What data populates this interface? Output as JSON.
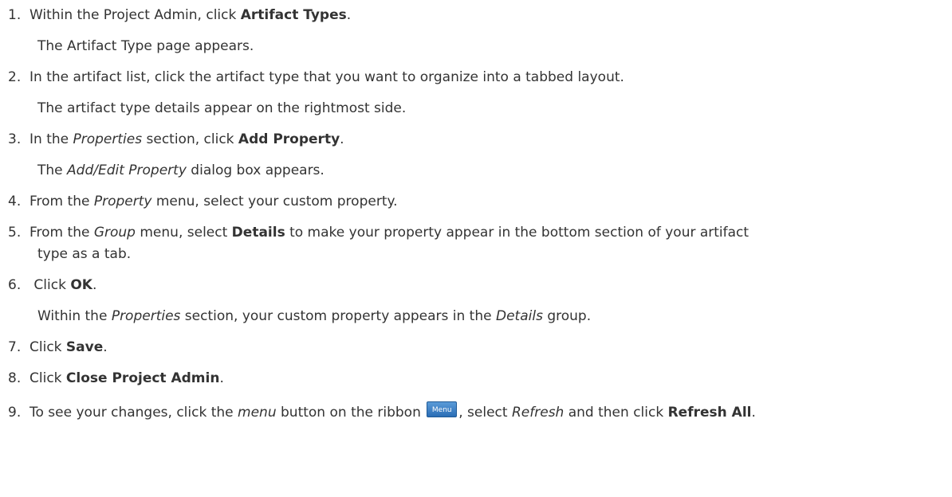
{
  "steps": [
    {
      "num": "1.",
      "pre": "Within the Project Admin, click ",
      "b1": "Artifact Types",
      "post": ".",
      "result": "The Artifact Type page appears."
    },
    {
      "num": "2.",
      "text": "In the artifact list, click the artifact type that you want to organize into a tabbed layout.",
      "result": "The artifact type details appear on the rightmost side."
    },
    {
      "num": "3.",
      "pre": "In the ",
      "i1": "Properties",
      "mid": " section, click ",
      "b1": "Add Property",
      "post": ".",
      "result_pre": "The ",
      "result_i": "Add/Edit Property",
      "result_post": " dialog box appears."
    },
    {
      "num": "4.",
      "pre": "From the ",
      "i1": "Property",
      "post": " menu, select your custom property."
    },
    {
      "num": "5.",
      "pre": "From the ",
      "i1": "Group",
      "mid": " menu, select ",
      "b1": "Details",
      "post": " to make your property appear in the bottom section of your artifact",
      "cont": "type as a tab."
    },
    {
      "num": "6.",
      "pre": " Click ",
      "b1": "OK",
      "post": ".",
      "result_pre": "Within the ",
      "result_i": "Properties",
      "result_mid": " section, your custom property appears in the ",
      "result_i2": "Details",
      "result_post": " group."
    },
    {
      "num": "7.",
      "pre": "Click ",
      "b1": "Save",
      "post": "."
    },
    {
      "num": "8.",
      "pre": "Click ",
      "b1": "Close Project Admin",
      "post": "."
    },
    {
      "num": "9.",
      "pre": "To see your changes, click the ",
      "i1": "menu",
      "mid": " button on the ribbon ",
      "button": "Menu",
      "mid2": ", select ",
      "i2": "Refresh",
      "mid3": " and then click ",
      "b1": "Refresh All",
      "post": "."
    }
  ]
}
